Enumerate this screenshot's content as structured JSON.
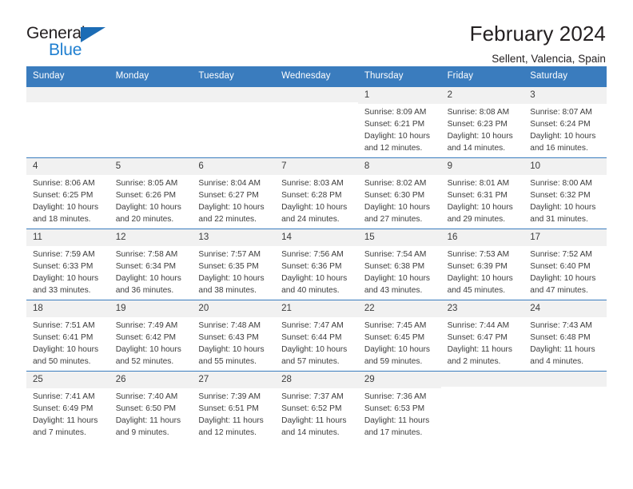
{
  "brand": {
    "name_part1": "General",
    "name_part2": "Blue",
    "accent_color": "#1f7fd0",
    "triangle_color": "#1c6cb5"
  },
  "header": {
    "title": "February 2024",
    "location": "Sellent, Valencia, Spain"
  },
  "theme": {
    "header_row_bg": "#3a7cbe",
    "daynum_bg": "#f1f1f1",
    "text_color": "#3c3c3c"
  },
  "weekday_headers": [
    "Sunday",
    "Monday",
    "Tuesday",
    "Wednesday",
    "Thursday",
    "Friday",
    "Saturday"
  ],
  "weeks": [
    [
      {
        "day": "",
        "empty": true
      },
      {
        "day": "",
        "empty": true
      },
      {
        "day": "",
        "empty": true
      },
      {
        "day": "",
        "empty": true
      },
      {
        "day": "1",
        "sunrise": "Sunrise: 8:09 AM",
        "sunset": "Sunset: 6:21 PM",
        "daylight": "Daylight: 10 hours and 12 minutes."
      },
      {
        "day": "2",
        "sunrise": "Sunrise: 8:08 AM",
        "sunset": "Sunset: 6:23 PM",
        "daylight": "Daylight: 10 hours and 14 minutes."
      },
      {
        "day": "3",
        "sunrise": "Sunrise: 8:07 AM",
        "sunset": "Sunset: 6:24 PM",
        "daylight": "Daylight: 10 hours and 16 minutes."
      }
    ],
    [
      {
        "day": "4",
        "sunrise": "Sunrise: 8:06 AM",
        "sunset": "Sunset: 6:25 PM",
        "daylight": "Daylight: 10 hours and 18 minutes."
      },
      {
        "day": "5",
        "sunrise": "Sunrise: 8:05 AM",
        "sunset": "Sunset: 6:26 PM",
        "daylight": "Daylight: 10 hours and 20 minutes."
      },
      {
        "day": "6",
        "sunrise": "Sunrise: 8:04 AM",
        "sunset": "Sunset: 6:27 PM",
        "daylight": "Daylight: 10 hours and 22 minutes."
      },
      {
        "day": "7",
        "sunrise": "Sunrise: 8:03 AM",
        "sunset": "Sunset: 6:28 PM",
        "daylight": "Daylight: 10 hours and 24 minutes."
      },
      {
        "day": "8",
        "sunrise": "Sunrise: 8:02 AM",
        "sunset": "Sunset: 6:30 PM",
        "daylight": "Daylight: 10 hours and 27 minutes."
      },
      {
        "day": "9",
        "sunrise": "Sunrise: 8:01 AM",
        "sunset": "Sunset: 6:31 PM",
        "daylight": "Daylight: 10 hours and 29 minutes."
      },
      {
        "day": "10",
        "sunrise": "Sunrise: 8:00 AM",
        "sunset": "Sunset: 6:32 PM",
        "daylight": "Daylight: 10 hours and 31 minutes."
      }
    ],
    [
      {
        "day": "11",
        "sunrise": "Sunrise: 7:59 AM",
        "sunset": "Sunset: 6:33 PM",
        "daylight": "Daylight: 10 hours and 33 minutes."
      },
      {
        "day": "12",
        "sunrise": "Sunrise: 7:58 AM",
        "sunset": "Sunset: 6:34 PM",
        "daylight": "Daylight: 10 hours and 36 minutes."
      },
      {
        "day": "13",
        "sunrise": "Sunrise: 7:57 AM",
        "sunset": "Sunset: 6:35 PM",
        "daylight": "Daylight: 10 hours and 38 minutes."
      },
      {
        "day": "14",
        "sunrise": "Sunrise: 7:56 AM",
        "sunset": "Sunset: 6:36 PM",
        "daylight": "Daylight: 10 hours and 40 minutes."
      },
      {
        "day": "15",
        "sunrise": "Sunrise: 7:54 AM",
        "sunset": "Sunset: 6:38 PM",
        "daylight": "Daylight: 10 hours and 43 minutes."
      },
      {
        "day": "16",
        "sunrise": "Sunrise: 7:53 AM",
        "sunset": "Sunset: 6:39 PM",
        "daylight": "Daylight: 10 hours and 45 minutes."
      },
      {
        "day": "17",
        "sunrise": "Sunrise: 7:52 AM",
        "sunset": "Sunset: 6:40 PM",
        "daylight": "Daylight: 10 hours and 47 minutes."
      }
    ],
    [
      {
        "day": "18",
        "sunrise": "Sunrise: 7:51 AM",
        "sunset": "Sunset: 6:41 PM",
        "daylight": "Daylight: 10 hours and 50 minutes."
      },
      {
        "day": "19",
        "sunrise": "Sunrise: 7:49 AM",
        "sunset": "Sunset: 6:42 PM",
        "daylight": "Daylight: 10 hours and 52 minutes."
      },
      {
        "day": "20",
        "sunrise": "Sunrise: 7:48 AM",
        "sunset": "Sunset: 6:43 PM",
        "daylight": "Daylight: 10 hours and 55 minutes."
      },
      {
        "day": "21",
        "sunrise": "Sunrise: 7:47 AM",
        "sunset": "Sunset: 6:44 PM",
        "daylight": "Daylight: 10 hours and 57 minutes."
      },
      {
        "day": "22",
        "sunrise": "Sunrise: 7:45 AM",
        "sunset": "Sunset: 6:45 PM",
        "daylight": "Daylight: 10 hours and 59 minutes."
      },
      {
        "day": "23",
        "sunrise": "Sunrise: 7:44 AM",
        "sunset": "Sunset: 6:47 PM",
        "daylight": "Daylight: 11 hours and 2 minutes."
      },
      {
        "day": "24",
        "sunrise": "Sunrise: 7:43 AM",
        "sunset": "Sunset: 6:48 PM",
        "daylight": "Daylight: 11 hours and 4 minutes."
      }
    ],
    [
      {
        "day": "25",
        "sunrise": "Sunrise: 7:41 AM",
        "sunset": "Sunset: 6:49 PM",
        "daylight": "Daylight: 11 hours and 7 minutes."
      },
      {
        "day": "26",
        "sunrise": "Sunrise: 7:40 AM",
        "sunset": "Sunset: 6:50 PM",
        "daylight": "Daylight: 11 hours and 9 minutes."
      },
      {
        "day": "27",
        "sunrise": "Sunrise: 7:39 AM",
        "sunset": "Sunset: 6:51 PM",
        "daylight": "Daylight: 11 hours and 12 minutes."
      },
      {
        "day": "28",
        "sunrise": "Sunrise: 7:37 AM",
        "sunset": "Sunset: 6:52 PM",
        "daylight": "Daylight: 11 hours and 14 minutes."
      },
      {
        "day": "29",
        "sunrise": "Sunrise: 7:36 AM",
        "sunset": "Sunset: 6:53 PM",
        "daylight": "Daylight: 11 hours and 17 minutes."
      },
      {
        "day": "",
        "empty": true
      },
      {
        "day": "",
        "empty": true
      }
    ]
  ]
}
